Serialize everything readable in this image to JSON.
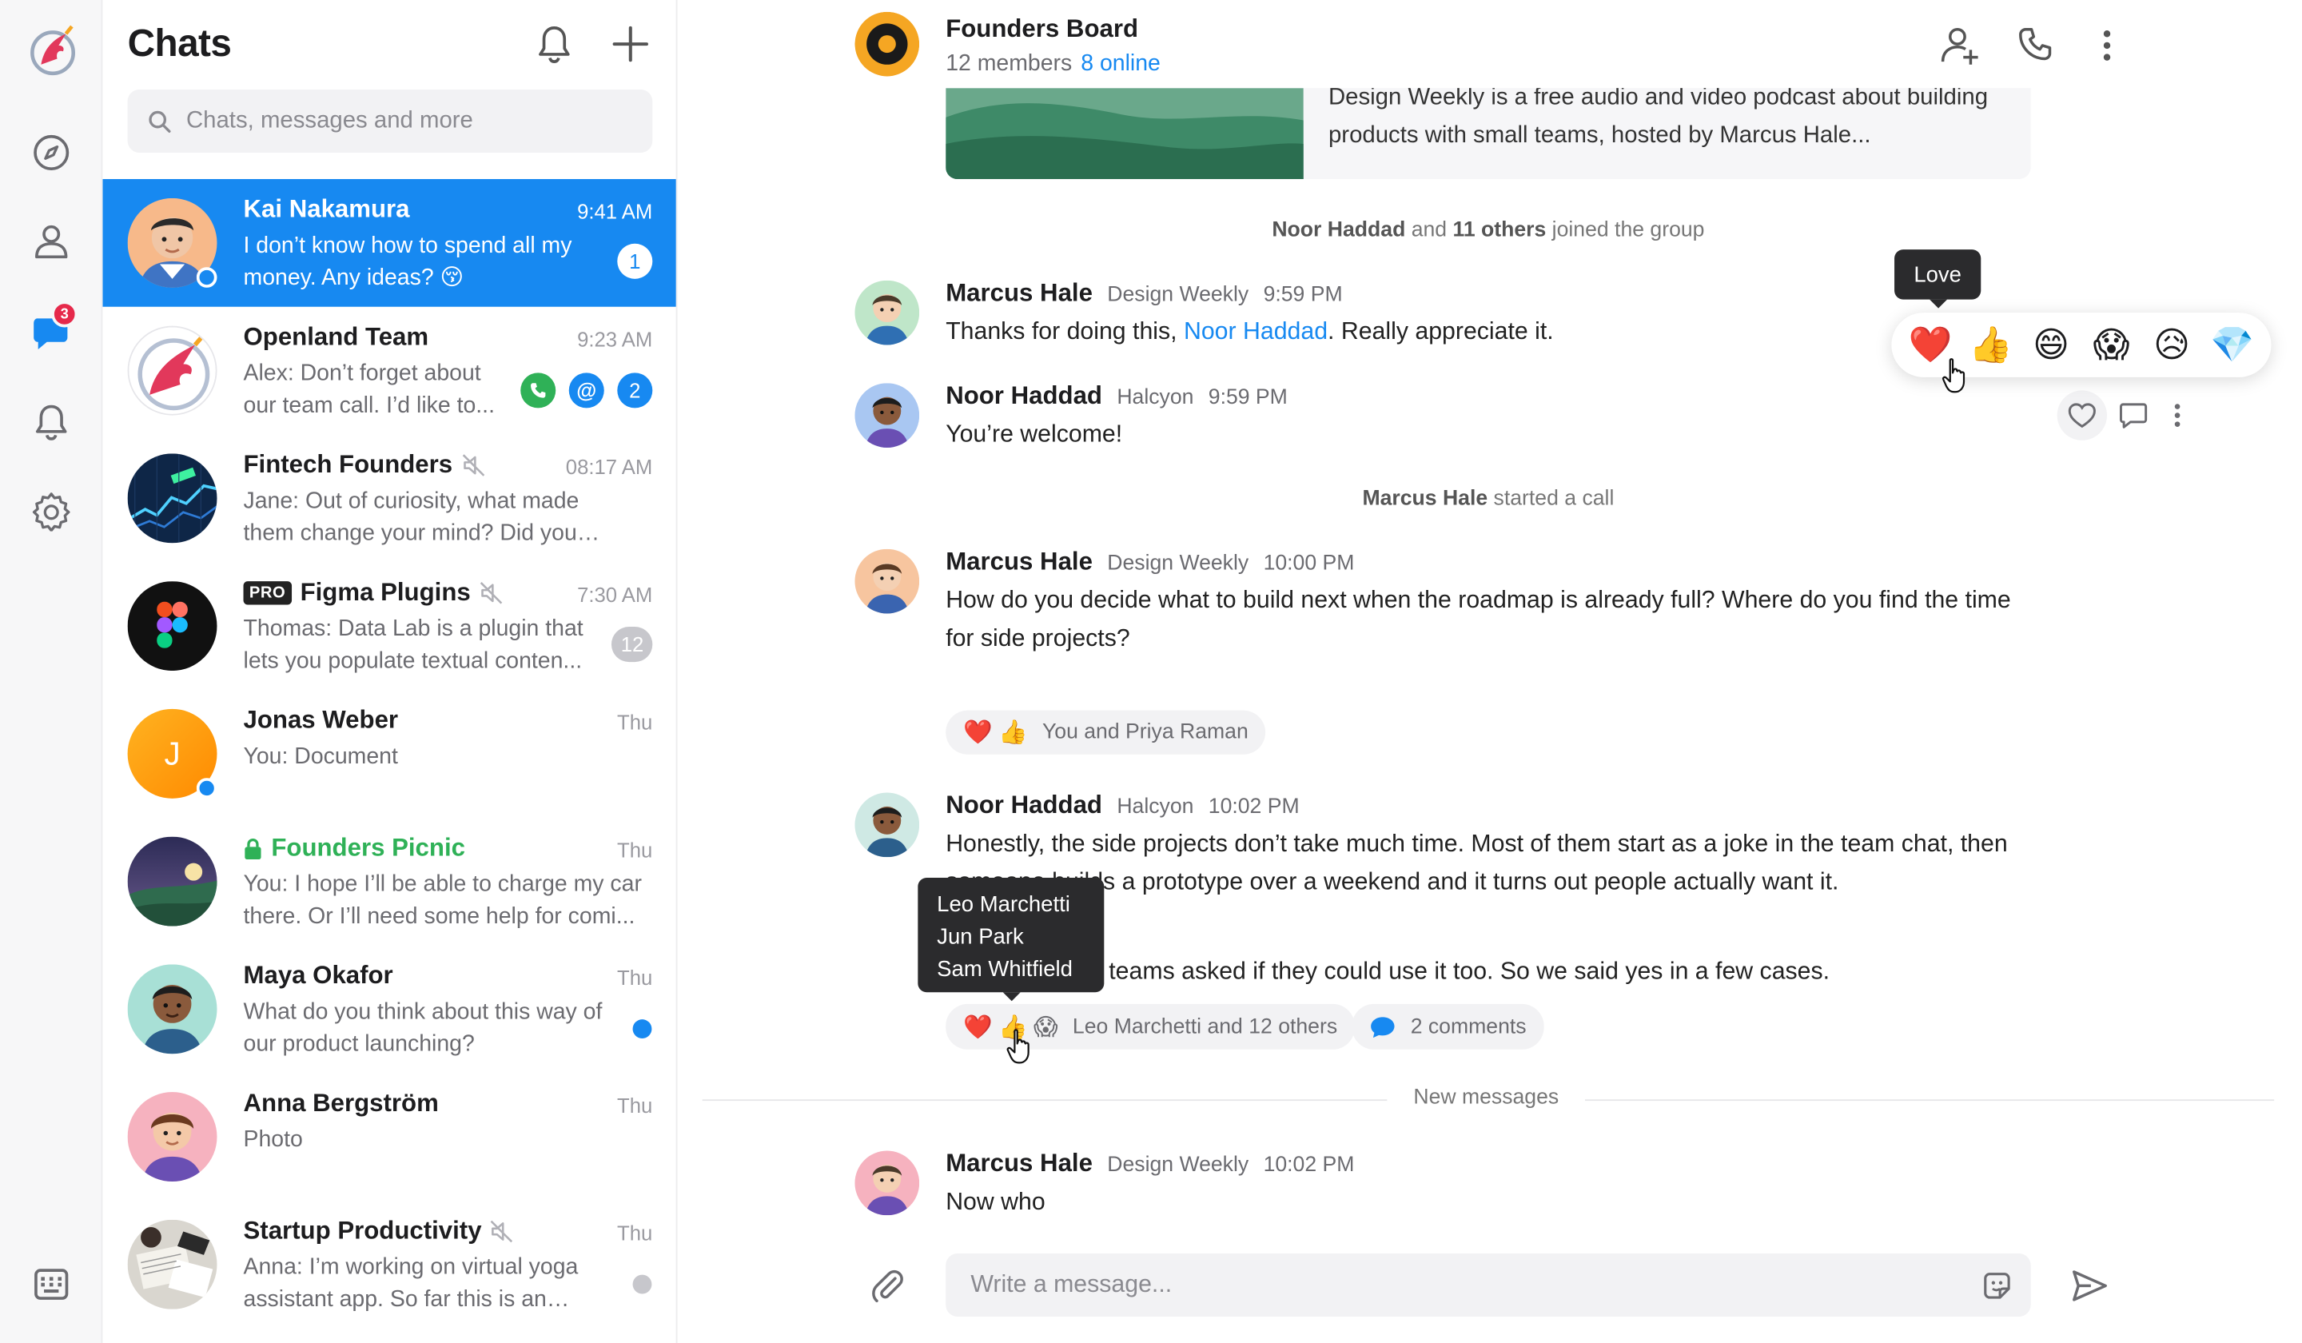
{
  "rail": {
    "messages_badge": "3"
  },
  "list": {
    "title": "Chats",
    "search_placeholder": "Chats, messages and more",
    "chats": [
      {
        "name": "Kai Nakamura",
        "time": "9:41 AM",
        "preview": "I don’t know how to spend all my money. Any ideas? 😚",
        "count": "1"
      },
      {
        "name": "Openland Team",
        "time": "9:23 AM",
        "preview": "Alex: Don’t forget about our team call. I’d like to...",
        "count": "2"
      },
      {
        "name": "Fintech Founders",
        "time": "08:17 AM",
        "preview": "Jane: Out of curiosity, what made them change your mind? Did you pivot idea?"
      },
      {
        "name": "Figma Plugins",
        "badge": "PRO",
        "time": "7:30 AM",
        "preview": "Thomas: Data Lab is a plugin that lets you populate textual conten...",
        "count": "12"
      },
      {
        "name": "Jonas Weber",
        "initial": "J",
        "time": "Thu",
        "preview": "You: Document"
      },
      {
        "name": "Founders Picnic",
        "time": "Thu",
        "preview": "You: I hope I’ll be able to charge my car there. Or I’ll need some help for comi..."
      },
      {
        "name": "Maya Okafor",
        "time": "Thu",
        "preview": "What do you think about this way of our product launching?"
      },
      {
        "name": "Anna Bergström",
        "time": "Thu",
        "preview": "Photo"
      },
      {
        "name": "Startup Productivity",
        "time": "Thu",
        "preview": "Anna: I’m working on virtual yoga assistant app. So far this is an iOS..."
      }
    ]
  },
  "group": {
    "title": "Founders Board",
    "members": "12 members",
    "online": "8 online"
  },
  "link_preview": {
    "text": "Design Weekly is a free audio and video podcast about building products with small teams, hosted by Marcus Hale..."
  },
  "system": {
    "joined_name": "Noor Haddad",
    "joined_mid": " and ",
    "joined_count": "11 others",
    "joined_end": " joined the group",
    "call_name": "Marcus Hale",
    "call_end": " started a call"
  },
  "messages": [
    {
      "name": "Marcus Hale",
      "org": "Design Weekly",
      "time": "9:59 PM",
      "text_a": "Thanks for doing this, ",
      "mention": "Noor Haddad",
      "text_b": ". Really appreciate it."
    },
    {
      "name": "Noor Haddad",
      "org": "Halcyon",
      "time": "9:59 PM",
      "text": "You’re welcome!"
    },
    {
      "name": "Marcus Hale",
      "org": "Design Weekly",
      "time": "10:00 PM",
      "text": "How do you decide what to build next when the roadmap is already full? Where do you find the time for side projects?",
      "reactions": "You and Priya Raman"
    },
    {
      "name": "Noor Haddad",
      "org": "Halcyon",
      "time": "10:02 PM",
      "text": "Honestly, the side projects don’t take much time. Most of them start as a joke in the team chat, then someone builds a prototype over a weekend and it turns out people actually want it.",
      "text2_visible": "er teams asked if they could use it too. So we said yes in a few cases.",
      "reactions": "Leo Marchetti and 12 others",
      "comments": "2 comments"
    },
    {
      "name": "Marcus Hale",
      "org": "Design Weekly",
      "time": "10:02 PM",
      "text": "Now who"
    }
  ],
  "reaction_picker": {
    "tooltip": "Love",
    "emojis": [
      "❤️",
      "👍",
      "😄",
      "😱",
      "😥",
      "💎"
    ]
  },
  "reactors_tooltip": [
    "Leo Marchetti",
    "Jun Park",
    "Sam Whitfield"
  ],
  "new_messages_label": "New messages",
  "composer": {
    "placeholder": "Write a message..."
  },
  "colors": {
    "accent": "#1789f1",
    "secure_green": "#2fb157",
    "badge_red": "#e6294b"
  }
}
